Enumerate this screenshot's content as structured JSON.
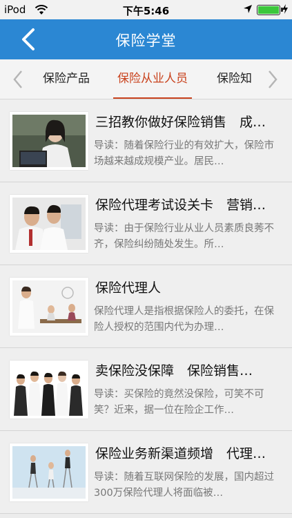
{
  "status_bar": {
    "carrier": "iPod",
    "time": "下午5:46",
    "battery_level": 1.0
  },
  "nav": {
    "title": "保险学堂"
  },
  "tabs": [
    {
      "label": "保险产品",
      "selected": false
    },
    {
      "label": "保险从业人员",
      "selected": true
    },
    {
      "label": "保险知",
      "selected": false
    }
  ],
  "articles": [
    {
      "title": "三招教你做好保险销售　成…",
      "desc": "导读：随着保险行业的有效扩大，保险市场越来越成规模产业。居民…"
    },
    {
      "title": "保险代理考试设关卡　营销…",
      "desc": "导读：由于保险行业从业人员素质良莠不齐，保险纠纷随处发生。所…"
    },
    {
      "title": "保险代理人",
      "desc": "保险代理人是指根据保险人的委托，在保险人授权的范围内代为办理…"
    },
    {
      "title": "卖保险没保障　保险销售…",
      "desc": "导读：买保险的竟然没保险，可笑不可笑？近来，据一位在险企工作…"
    },
    {
      "title": "保险业务新渠道频增　代理…",
      "desc": "导读：随着互联网保险的发展，国内超过300万保险代理人将面临被…"
    }
  ],
  "colors": {
    "nav_blue": "#2b87d3",
    "tab_active": "#c9421d"
  }
}
